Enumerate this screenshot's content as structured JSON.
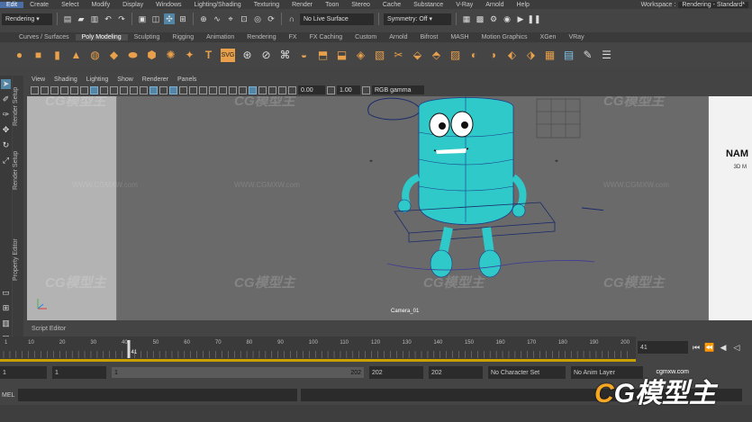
{
  "menu": {
    "items": [
      "Edit",
      "Create",
      "Select",
      "Modify",
      "Display",
      "Windows",
      "Lighting/Shading",
      "Texturing",
      "Render",
      "Toon",
      "Stereo",
      "Cache",
      "Substance",
      "V-Ray",
      "Arnold",
      "Help"
    ],
    "active_index": 0,
    "workspace_label": "Workspace :",
    "workspace_value": "Rendering - Standard*"
  },
  "status_line": {
    "menuset": "Rendering",
    "live_surface": "No Live Surface",
    "symmetry": "Symmetry: Off"
  },
  "shelf": {
    "tabs": [
      "Curves / Surfaces",
      "Poly Modeling",
      "Sculpting",
      "Rigging",
      "Animation",
      "Rendering",
      "FX",
      "FX Caching",
      "Custom",
      "Arnold",
      "Bifrost",
      "MASH",
      "Motion Graphics",
      "XGen",
      "VRay"
    ],
    "active_index": 1,
    "svg_label": "SVG",
    "text_label": "T"
  },
  "side_tabs": [
    "Render Setup",
    "Property Editor",
    "Render Setup"
  ],
  "panel": {
    "menus": [
      "View",
      "Shading",
      "Lighting",
      "Show",
      "Renderer",
      "Panels"
    ],
    "exposure": "0.00",
    "gamma": "1.00",
    "color_space": "RGB gamma"
  },
  "viewport": {
    "camera_label": "Camera_01",
    "logo_text": "NAM",
    "logo_sub": "3D M",
    "watermark_brand": "CG模型主",
    "watermark_url": "WWW.CGMXW.com"
  },
  "script_editor": {
    "label": "Script Editor"
  },
  "timeline": {
    "ticks": [
      "10",
      "20",
      "30",
      "40",
      "50",
      "60",
      "70",
      "80",
      "90",
      "100",
      "110",
      "120",
      "130",
      "140",
      "150",
      "160",
      "170",
      "180",
      "190",
      "200"
    ],
    "first_tick": "1",
    "current_frame": "41",
    "current_frame_field": "41",
    "playback_current": 41,
    "playback_start": 1,
    "playback_end": 202
  },
  "range": {
    "start_field": "1",
    "inner_start": "1",
    "inner_start_bar": "1",
    "inner_end_bar": "202",
    "end_field_1": "202",
    "end_field_2": "202",
    "character_set": "No Character Set",
    "anim_layer": "No Anim Layer"
  },
  "command_line": {
    "label": "MEL"
  },
  "brand": {
    "url": "cgmxw.com",
    "text_c": "C",
    "text_rest": "G模型主"
  }
}
